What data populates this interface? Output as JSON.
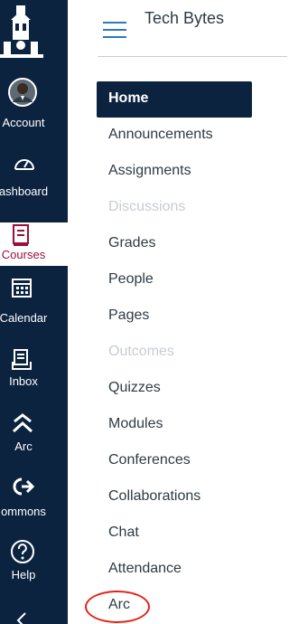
{
  "header": {
    "course_title": "Tech Bytes"
  },
  "global_nav": {
    "items": [
      {
        "label": "Account"
      },
      {
        "label": "ashboard"
      },
      {
        "label": "Courses"
      },
      {
        "label": "Calendar"
      },
      {
        "label": "Inbox"
      },
      {
        "label": "Arc"
      },
      {
        "label": "ommons"
      },
      {
        "label": "Help"
      }
    ]
  },
  "course_nav": {
    "items": [
      {
        "label": "Home",
        "state": "active"
      },
      {
        "label": "Announcements"
      },
      {
        "label": "Assignments"
      },
      {
        "label": "Discussions",
        "state": "disabled"
      },
      {
        "label": "Grades"
      },
      {
        "label": "People"
      },
      {
        "label": "Pages"
      },
      {
        "label": "Outcomes",
        "state": "disabled"
      },
      {
        "label": "Quizzes"
      },
      {
        "label": "Modules"
      },
      {
        "label": "Conferences"
      },
      {
        "label": "Collaborations"
      },
      {
        "label": "Chat"
      },
      {
        "label": "Attendance"
      },
      {
        "label": "Arc",
        "annotation": "red-circle"
      }
    ]
  },
  "colors": {
    "rail_bg": "#0c2340",
    "active_course_item": "#0c2340",
    "courses_active_text": "#9b0f3a",
    "hamburger": "#2b7abc",
    "annotation_circle": "#e2231a",
    "disabled_text": "#c7cdd1"
  }
}
